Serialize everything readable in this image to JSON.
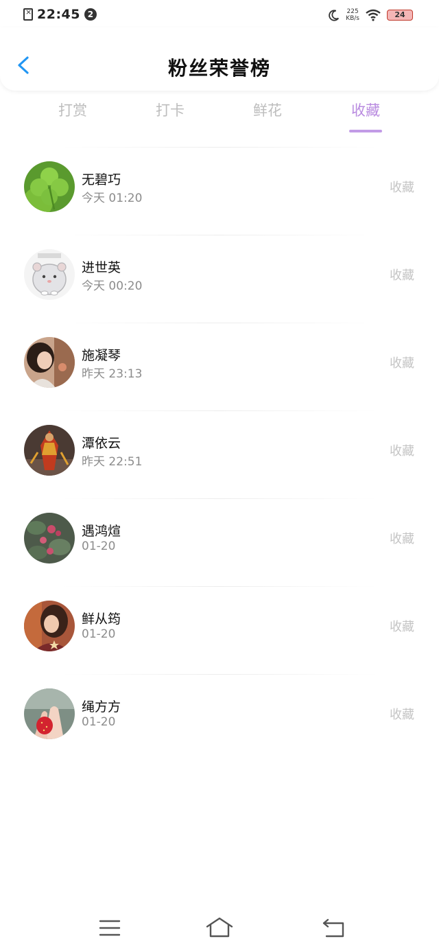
{
  "status_bar": {
    "time": "22:45",
    "notification_count": "2",
    "net_speed_value": "225",
    "net_speed_unit": "KB/s",
    "battery": "24"
  },
  "header": {
    "title": "粉丝荣誉榜",
    "back_icon": "chevron-left-icon"
  },
  "tabs": [
    {
      "label": "打赏",
      "active": false
    },
    {
      "label": "打卡",
      "active": false
    },
    {
      "label": "鲜花",
      "active": false
    },
    {
      "label": "收藏",
      "active": true
    }
  ],
  "colors": {
    "accent": "#b98be0",
    "back_icon": "#2196f3"
  },
  "fans": [
    {
      "name": "无碧巧",
      "time": "今天 01:20",
      "action": "收藏",
      "avatar": "clover-photo"
    },
    {
      "name": "进世英",
      "time": "今天 00:20",
      "action": "收藏",
      "avatar": "hamster-sticker"
    },
    {
      "name": "施凝琴",
      "time": "昨天 23:13",
      "action": "收藏",
      "avatar": "portrait-photo"
    },
    {
      "name": "潭依云",
      "time": "昨天 22:51",
      "action": "收藏",
      "avatar": "game-character"
    },
    {
      "name": "遇鸿煊",
      "time": "01-20",
      "action": "收藏",
      "avatar": "flower-photo"
    },
    {
      "name": "鲜从筠",
      "time": "01-20",
      "action": "收藏",
      "avatar": "portrait-photo"
    },
    {
      "name": "绳方方",
      "time": "01-20",
      "action": "收藏",
      "avatar": "strawberry-photo"
    }
  ],
  "nav_bar": {
    "menu_icon": "menu-icon",
    "home_icon": "home-icon",
    "back_icon": "back-icon"
  }
}
